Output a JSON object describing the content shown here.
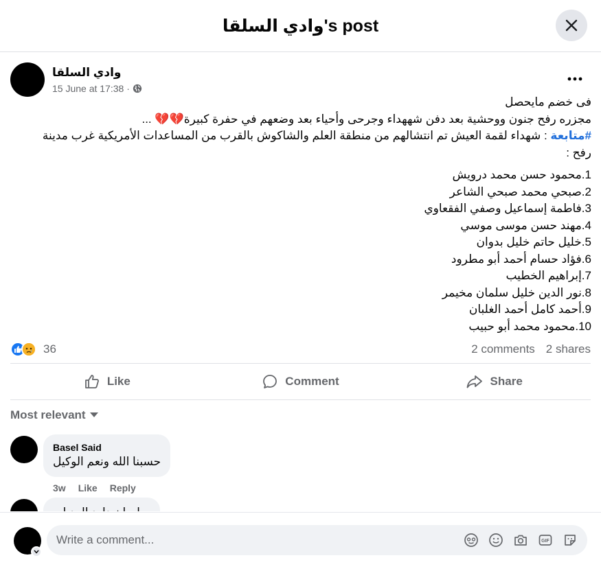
{
  "header": {
    "title": "وادي السلقا's post"
  },
  "post": {
    "author": "وادي السلقا",
    "timestamp": "15 June at 17:38 ·",
    "text": {
      "line1": "فى خضم مايحصل",
      "line2": "مجزره رفح جنون ووحشية بعد دفن شههداء وجرحى وأحياء بعد وضعهم في حفرة كبيرة💔💔 ...",
      "hashtag": "#متابعة",
      "line3_rest": " : شهداء لقمة العيش تم انتشالهم من منطقة العلم والشاكوش بالقرب من المساعدات الأمريكية غرب مدينة رفح :"
    },
    "list": [
      "1.محمود حسن محمد درويش",
      "2.صبحي محمد صبحي الشاعر",
      "3.فاطمة إسماعيل وصفي الفقعاوي",
      "4.مهند حسن موسى موسي",
      "5.خليل حاتم خليل بدوان",
      "6.فؤاد حسام أحمد أبو مطرود",
      "7.إبراهيم  الخطيب",
      "8.نور الدين خليل سلمان مخيمر",
      "9.أحمد كامل أحمد الغلبان",
      "10.محمود محمد أبو حبيب"
    ],
    "reaction_count": "36",
    "comments_count": "2 comments",
    "shares_count": "2 shares"
  },
  "actions": {
    "like": "Like",
    "comment": "Comment",
    "share": "Share"
  },
  "sort_label": "Most relevant",
  "comments": [
    {
      "name": "Basel Said",
      "text": "حسبنا الله ونعم الوكيل",
      "time": "3w",
      "like": "Like",
      "reply": "Reply"
    },
    {
      "name": "",
      "text": "سليمان داود العديلي"
    }
  ],
  "composer": {
    "placeholder": "Write a comment..."
  },
  "colors": {
    "accent": "#1877f2",
    "hashtag": "#216fdb",
    "muted": "#65676b",
    "bubble": "#f0f2f5"
  }
}
